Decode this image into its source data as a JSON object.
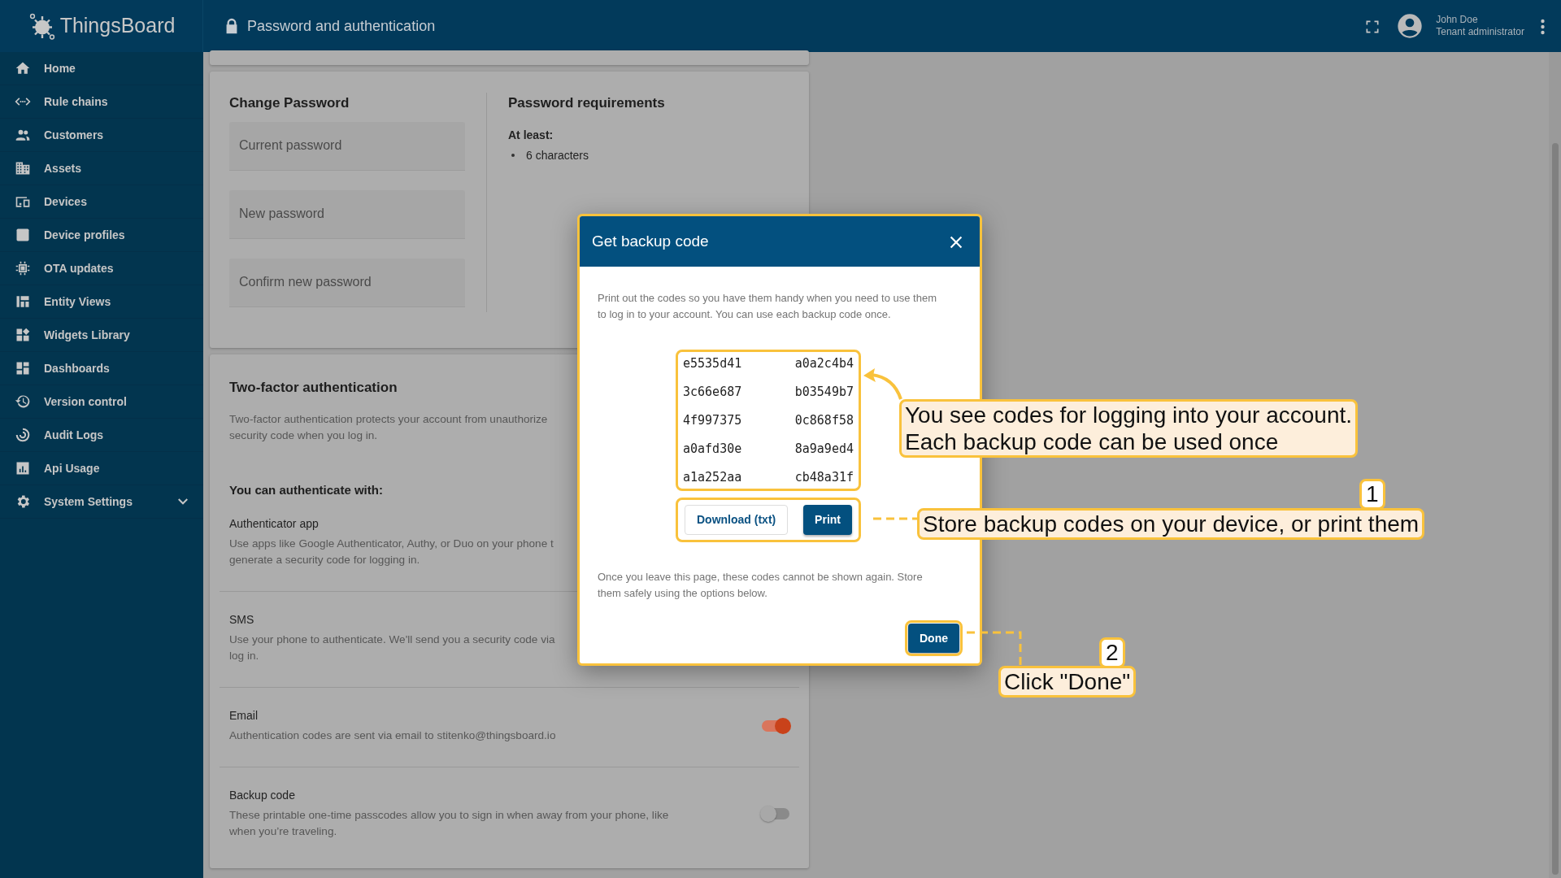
{
  "header": {
    "logo_text": "ThingsBoard",
    "title": "Password and authentication",
    "user_name": "John Doe",
    "user_role": "Tenant administrator"
  },
  "sidebar": {
    "items": [
      {
        "label": "Home",
        "kind": "link"
      },
      {
        "label": "Rule chains",
        "kind": "link"
      },
      {
        "label": "Customers",
        "kind": "link"
      },
      {
        "label": "Assets",
        "kind": "link"
      },
      {
        "label": "Devices",
        "kind": "link"
      },
      {
        "label": "Device profiles",
        "kind": "link"
      },
      {
        "label": "OTA updates",
        "kind": "link"
      },
      {
        "label": "Entity Views",
        "kind": "link"
      },
      {
        "label": "Widgets Library",
        "kind": "link"
      },
      {
        "label": "Dashboards",
        "kind": "link"
      },
      {
        "label": "Version control",
        "kind": "link"
      },
      {
        "label": "Audit Logs",
        "kind": "link"
      },
      {
        "label": "Api Usage",
        "kind": "link"
      },
      {
        "label": "System Settings",
        "kind": "group"
      }
    ]
  },
  "change_password": {
    "title": "Change Password",
    "fields": [
      {
        "placeholder": "Current password"
      },
      {
        "placeholder": "New password"
      },
      {
        "placeholder": "Confirm new password"
      }
    ],
    "requirements": {
      "title": "Password requirements",
      "heading": "At least:",
      "items": [
        "6 characters"
      ]
    }
  },
  "two_factor": {
    "title": "Two-factor authentication",
    "description_lines": [
      "Two-factor authentication protects your account from unauthorize",
      "security code when you log in."
    ],
    "subtitle": "You can authenticate with:",
    "methods": [
      {
        "name": "Authenticator app",
        "kind": "text",
        "description_lines": [
          "Use apps like Google Authenticator, Authy, or Duo on your phone t",
          "generate a security code for logging in."
        ]
      },
      {
        "name": "SMS",
        "kind": "text",
        "description_lines": [
          "Use your phone to authenticate. We'll send you a security code via",
          "log in."
        ]
      },
      {
        "name": "Email",
        "kind": "toggle",
        "on": true,
        "description_lines": [
          "Authentication codes are sent via email to stitenko@thingsboard.io"
        ]
      },
      {
        "name": "Backup code",
        "kind": "toggle",
        "on": false,
        "description_lines": [
          "These printable one-time passcodes allow you to sign in when away from your phone, like",
          "when you’re traveling."
        ]
      }
    ]
  },
  "dialog": {
    "title": "Get backup code",
    "intro": "Print out the codes so you have them handy when you need to use them to log in to your account. You can use each backup code once.",
    "codes": [
      "e5535d41",
      "a0a2c4b4",
      "3c66e687",
      "b03549b7",
      "4f997375",
      "0c868f58",
      "a0afd30e",
      "8a9a9ed4",
      "a1a252aa",
      "cb48a31f"
    ],
    "download_button": "Download (txt)",
    "print_button": "Print",
    "outro": "Once you leave this page, these codes cannot be shown again. Store them safely using the options below.",
    "done_button": "Done"
  },
  "callouts": [
    {
      "kind": "arrow",
      "lines": [
        "You see codes for logging into your account.",
        "Each backup code can be used once"
      ]
    },
    {
      "kind": "step",
      "step": "1",
      "lines": [
        "Store backup codes on your device, or print them"
      ]
    },
    {
      "kind": "step",
      "step": "2",
      "lines": [
        "Click \"Done\""
      ]
    }
  ]
}
